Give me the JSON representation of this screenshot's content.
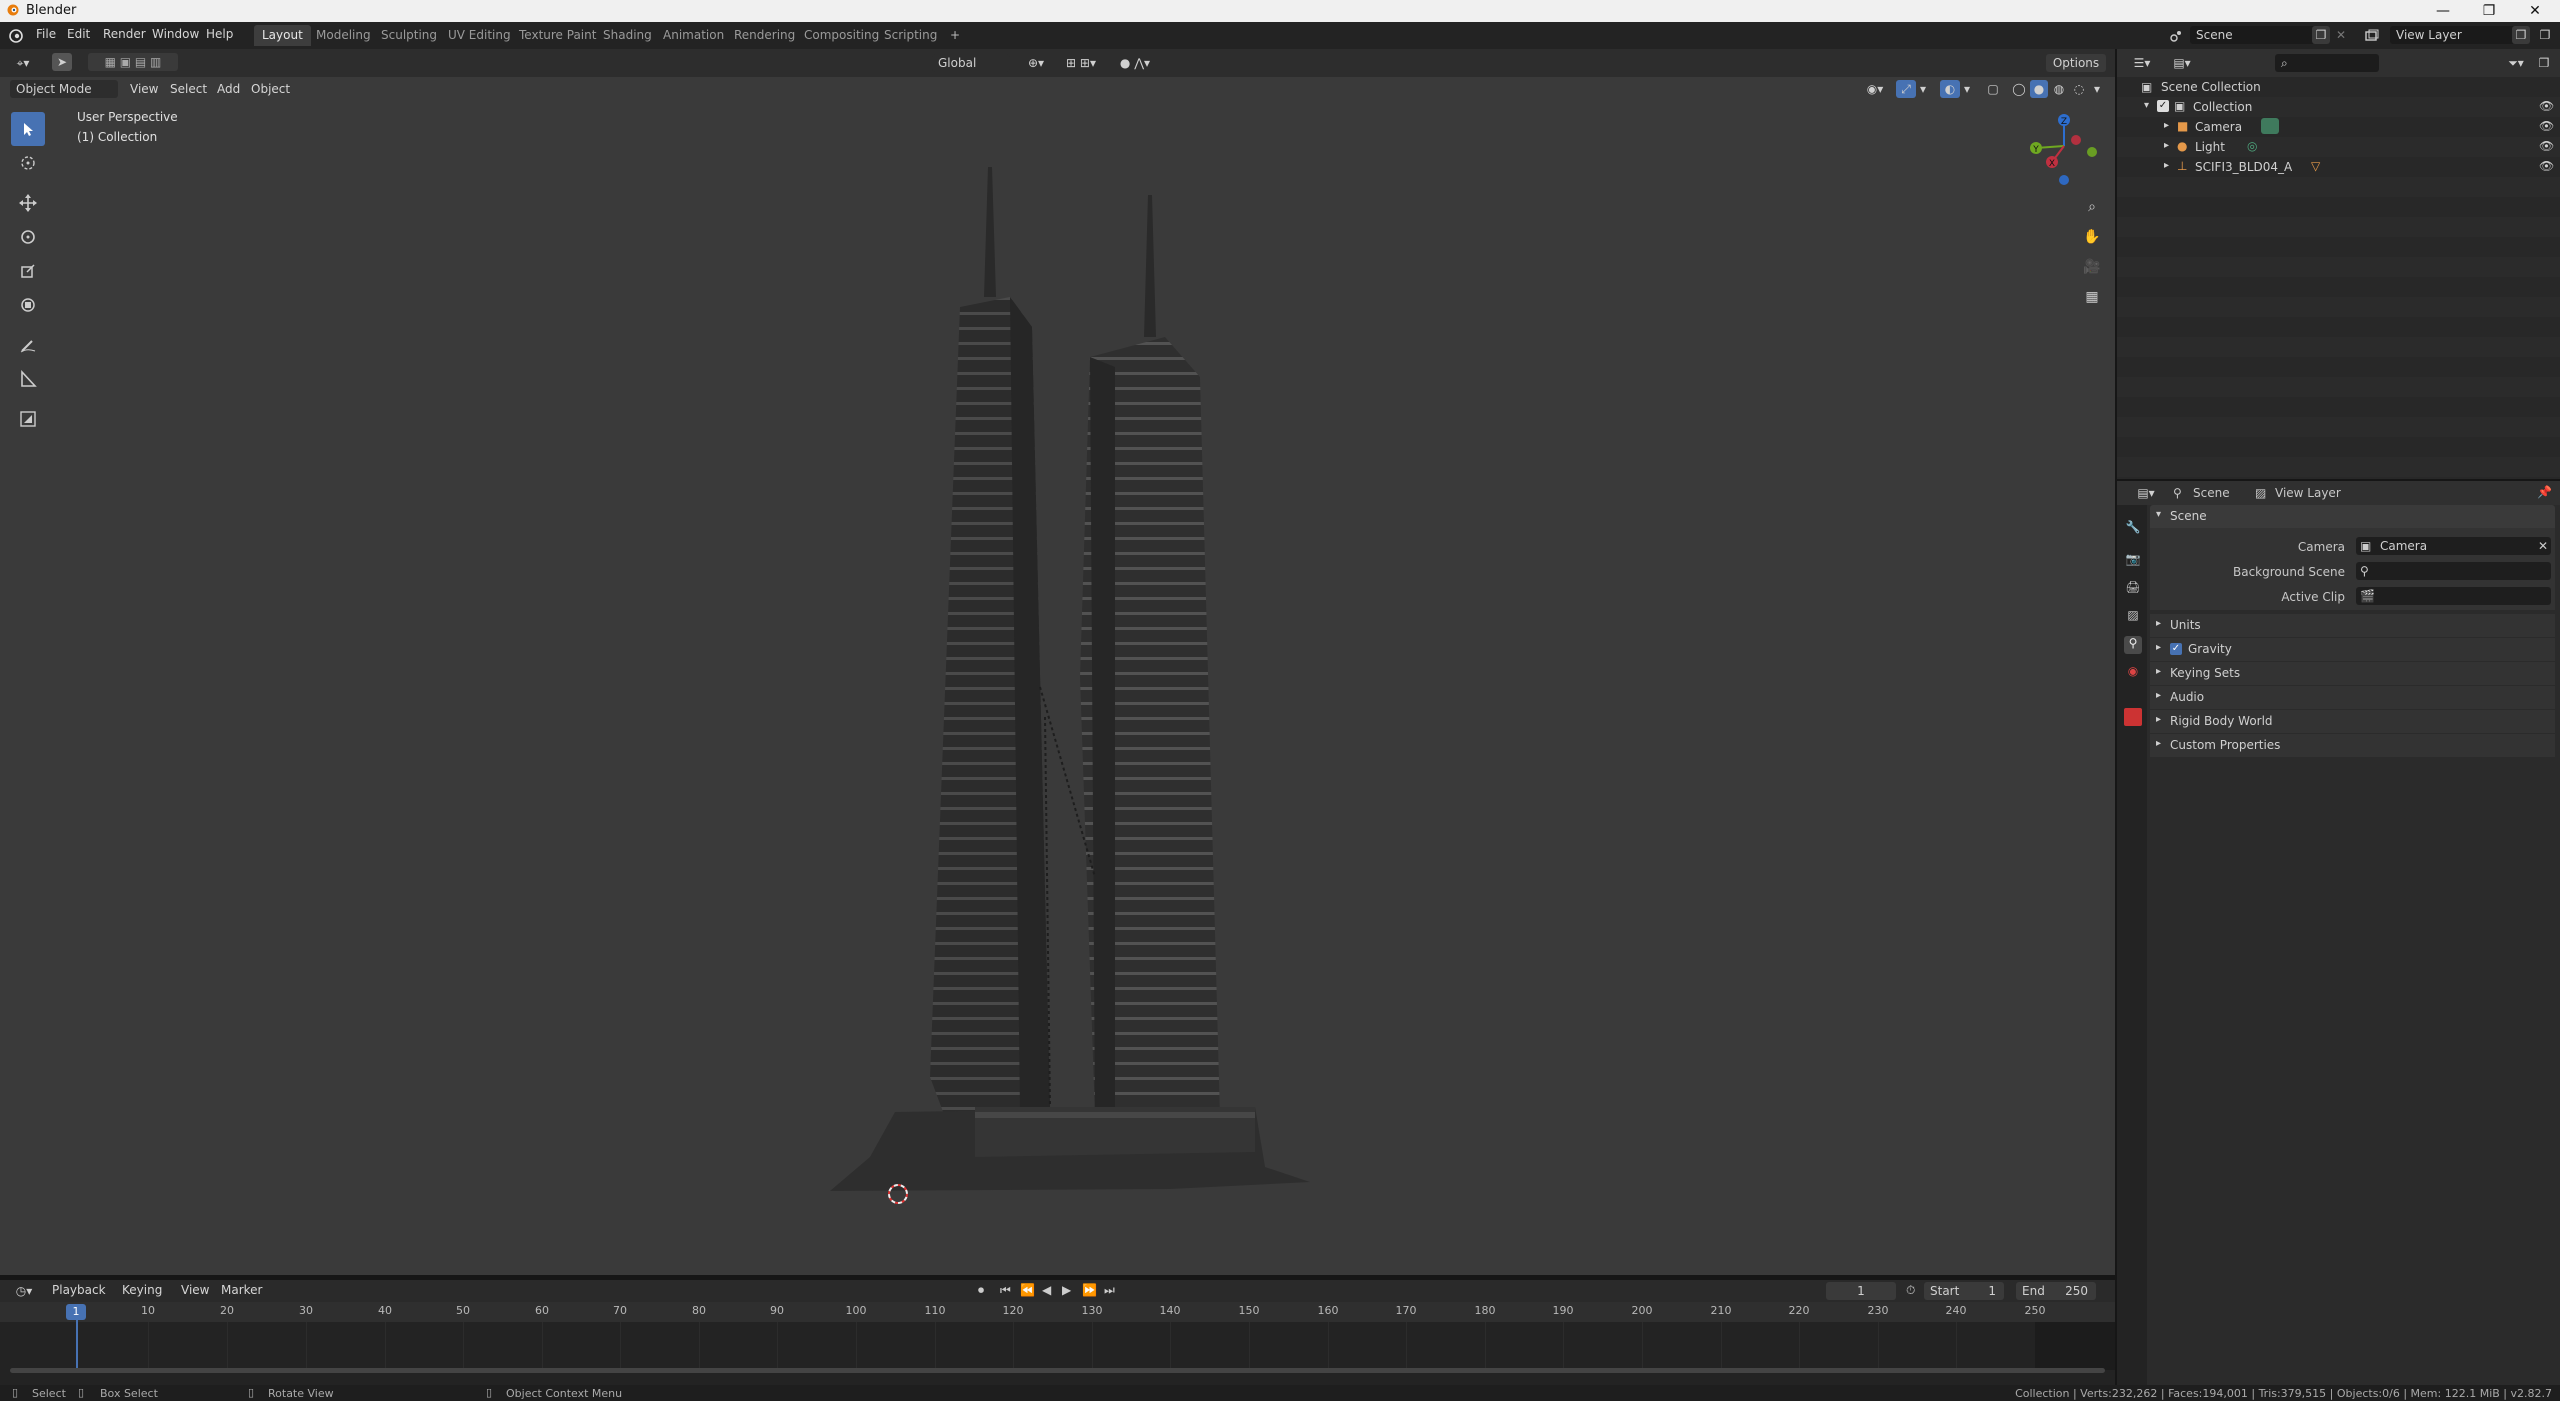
{
  "window": {
    "title": "Blender",
    "minimize": "—",
    "maximize": "❐",
    "close": "✕"
  },
  "menu": [
    "File",
    "Edit",
    "Render",
    "Window",
    "Help"
  ],
  "workspaces": [
    "Layout",
    "Modeling",
    "Sculpting",
    "UV Editing",
    "Texture Paint",
    "Shading",
    "Animation",
    "Rendering",
    "Compositing",
    "Scripting",
    "+"
  ],
  "active_workspace": "Layout",
  "scene_selector": {
    "value": "Scene"
  },
  "viewlayer_selector": {
    "value": "View Layer"
  },
  "viewport": {
    "mode": "Object Mode",
    "menus": [
      "View",
      "Select",
      "Add",
      "Object"
    ],
    "orientation": "Global",
    "options": "Options",
    "overlay_text_1": "User Perspective",
    "overlay_text_2": "(1) Collection",
    "gizmo": {
      "x": "X",
      "y": "Y",
      "z": "Z"
    }
  },
  "outliner": {
    "search_placeholder": "",
    "root": "Scene Collection",
    "items": [
      {
        "label": "Collection",
        "icon": "collection-icon"
      },
      {
        "label": "Camera",
        "icon": "camera-icon"
      },
      {
        "label": "Light",
        "icon": "light-icon"
      },
      {
        "label": "SCIFI3_BLD04_A",
        "icon": "mesh-icon"
      }
    ]
  },
  "properties": {
    "breadcrumb_scene": "Scene",
    "breadcrumb_viewlayer": "View Layer",
    "panel_title": "Scene",
    "fields": [
      {
        "label": "Camera",
        "value": "Camera"
      },
      {
        "label": "Background Scene",
        "value": ""
      },
      {
        "label": "Active Clip",
        "value": ""
      }
    ],
    "subpanels": [
      "Units",
      "Gravity",
      "Keying Sets",
      "Audio",
      "Rigid Body World",
      "Custom Properties"
    ],
    "gravity_checked": true
  },
  "timeline": {
    "menus": [
      "Playback",
      "Keying",
      "View",
      "Marker"
    ],
    "current_frame": "1",
    "start_label": "Start",
    "start": "1",
    "end_label": "End",
    "end": "250",
    "playhead": "1",
    "ticks": [
      "10",
      "20",
      "30",
      "40",
      "50",
      "60",
      "70",
      "80",
      "90",
      "100",
      "110",
      "120",
      "130",
      "140",
      "150",
      "160",
      "170",
      "180",
      "190",
      "200",
      "210",
      "220",
      "230",
      "240",
      "250"
    ]
  },
  "statusbar": {
    "select": "Select",
    "box_select": "Box Select",
    "rotate_view": "Rotate View",
    "context_menu": "Object Context Menu",
    "stats": "Collection | Verts:232,262 | Faces:194,001 | Tris:379,515 | Objects:0/6 | Mem: 122.1 MiB | v2.82.7"
  },
  "colors": {
    "accent": "#4772b3",
    "viewport_bg": "#3a3a3a",
    "panel_bg": "#2b2b2b"
  }
}
